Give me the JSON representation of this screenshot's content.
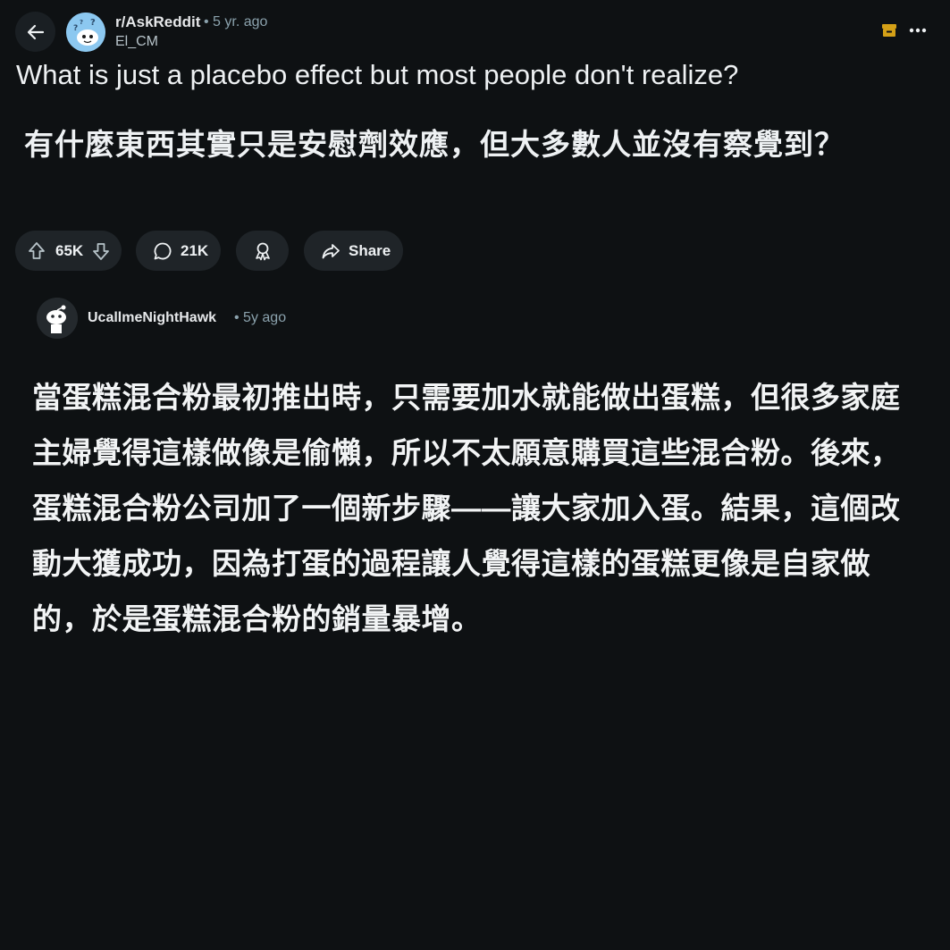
{
  "header": {
    "subreddit": "r/AskReddit",
    "meta": "• 5 yr. ago",
    "author": "El_CM"
  },
  "post": {
    "title": "What is just a placebo effect but most people don't realize?",
    "translation": "有什麼東西其實只是安慰劑效應，但大多數人並沒有察覺到？"
  },
  "actions": {
    "votes": "65K",
    "comments": "21K",
    "share_label": "Share"
  },
  "comment": {
    "author": "UcallmeNightHawk",
    "meta": "• 5y ago",
    "text": "當蛋糕混合粉最初推出時，只需要加水就能做出蛋糕，但很多家庭主婦覺得這樣做像是偷懶，所以不太願意購買這些混合粉。後來，蛋糕混合粉公司加了一個新步驟——讓大家加入蛋。結果，這個改動大獲成功，因為打蛋的過程讓人覺得這樣的蛋糕更像是自家做的，於是蛋糕混合粉的銷量暴增。"
  },
  "icons": {
    "back": "back-arrow-icon",
    "archive": "archive-icon",
    "more": "more-dots-icon",
    "upvote": "upvote-icon",
    "downvote": "downvote-icon",
    "comment": "comment-bubble-icon",
    "award": "award-icon",
    "share": "share-arrow-icon"
  },
  "colors": {
    "background": "#0e1113",
    "pill": "#1f2428",
    "archive_accent": "#d4a017",
    "subreddit_avatar": "#8cc8f0"
  }
}
